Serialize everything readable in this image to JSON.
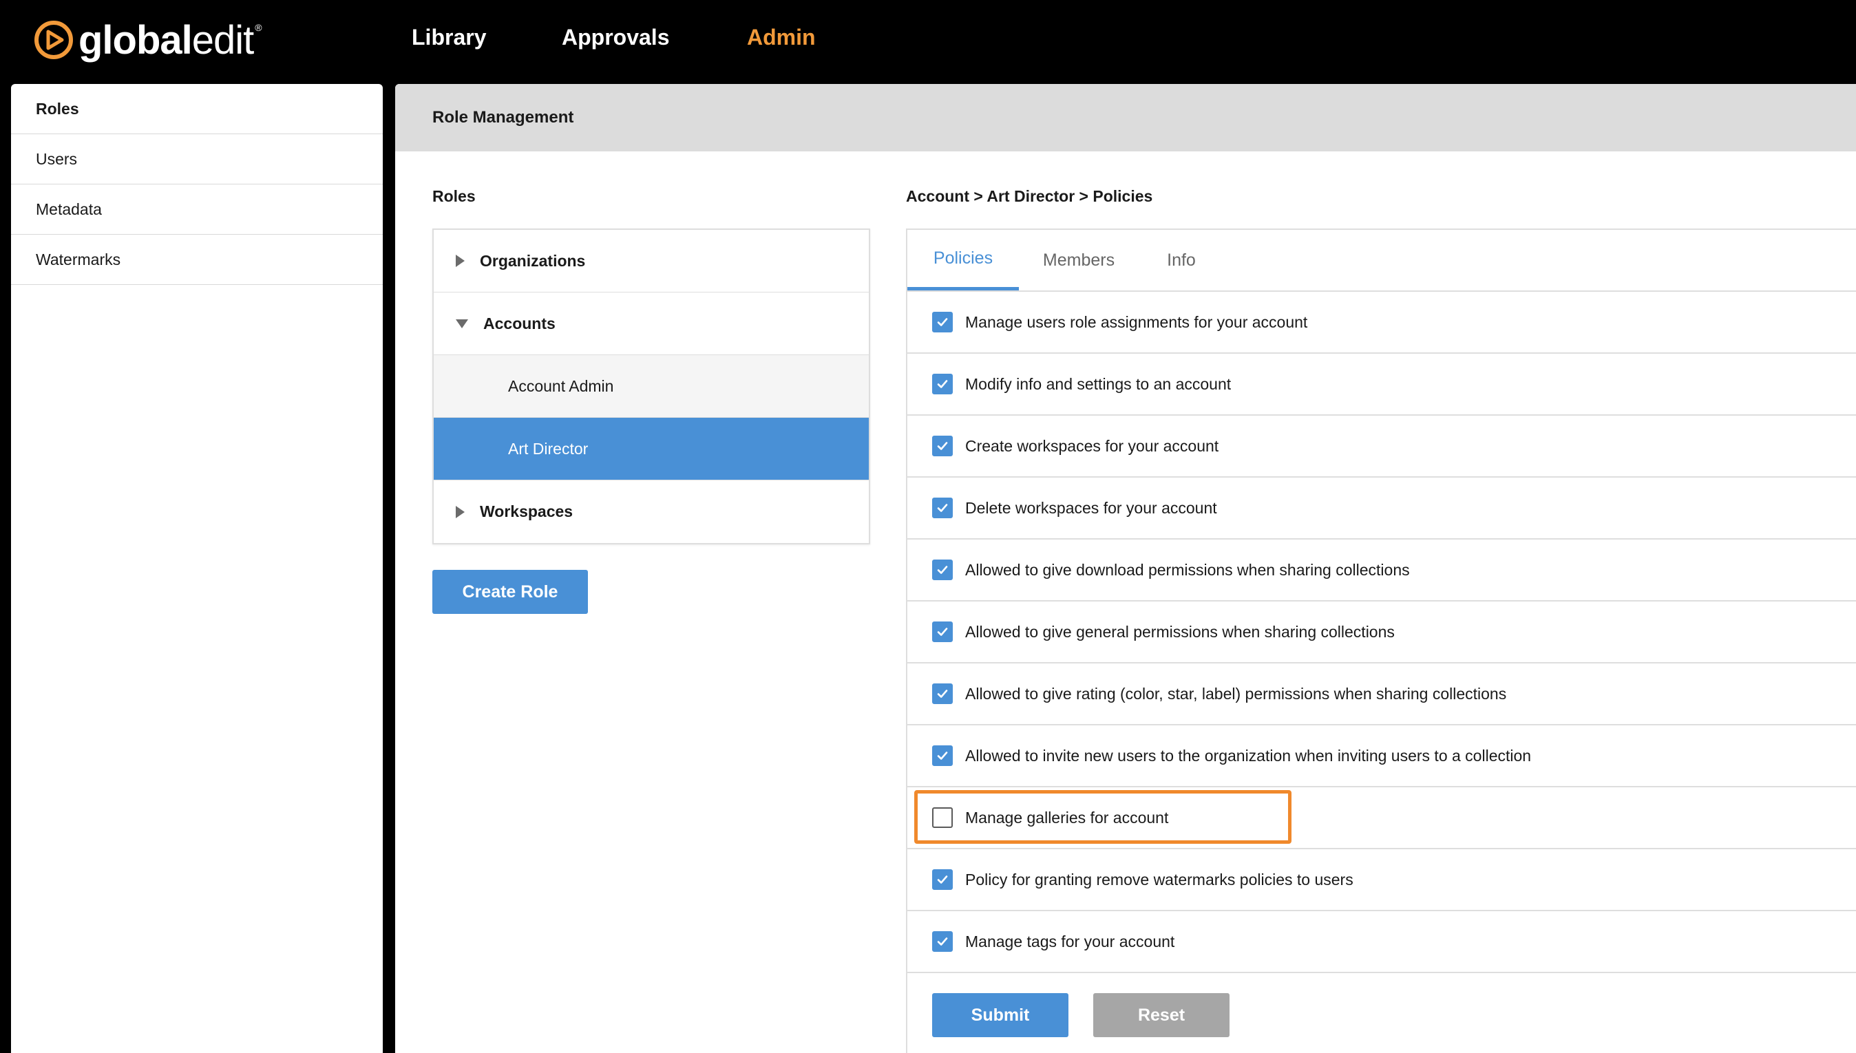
{
  "app": {
    "logo_text_bold": "global",
    "logo_text_light": "edit",
    "logo_reg": "®",
    "brand_color": "#f29a3a",
    "accent_color": "#4990d6"
  },
  "nav": {
    "library": "Library",
    "approvals": "Approvals",
    "admin": "Admin"
  },
  "sidebar": {
    "items": [
      {
        "label": "Roles",
        "active": true
      },
      {
        "label": "Users"
      },
      {
        "label": "Metadata"
      },
      {
        "label": "Watermarks"
      }
    ]
  },
  "main": {
    "header": "Role Management",
    "roles_title": "Roles",
    "breadcrumb": "Account > Art Director > Policies",
    "tree": {
      "organizations": "Organizations",
      "accounts": "Accounts",
      "account_admin": "Account Admin",
      "art_director": "Art Director",
      "workspaces": "Workspaces"
    },
    "create_role": "Create Role",
    "tabs": {
      "policies": "Policies",
      "members": "Members",
      "info": "Info"
    },
    "policies": [
      {
        "label": "Manage users role assignments for your account",
        "checked": true
      },
      {
        "label": "Modify info and settings to an account",
        "checked": true
      },
      {
        "label": "Create workspaces for your account",
        "checked": true
      },
      {
        "label": "Delete workspaces for your account",
        "checked": true
      },
      {
        "label": "Allowed to give download permissions when sharing collections",
        "checked": true
      },
      {
        "label": "Allowed to give general permissions when sharing collections",
        "checked": true
      },
      {
        "label": "Allowed to give rating (color, star, label) permissions when sharing collections",
        "checked": true
      },
      {
        "label": "Allowed to invite new users to the organization when inviting users to a collection",
        "checked": true
      },
      {
        "label": "Manage galleries for account",
        "checked": false
      },
      {
        "label": "Policy for granting remove watermarks policies to users",
        "checked": true
      },
      {
        "label": "Manage tags for your account",
        "checked": true
      }
    ],
    "submit": "Submit",
    "reset": "Reset"
  }
}
